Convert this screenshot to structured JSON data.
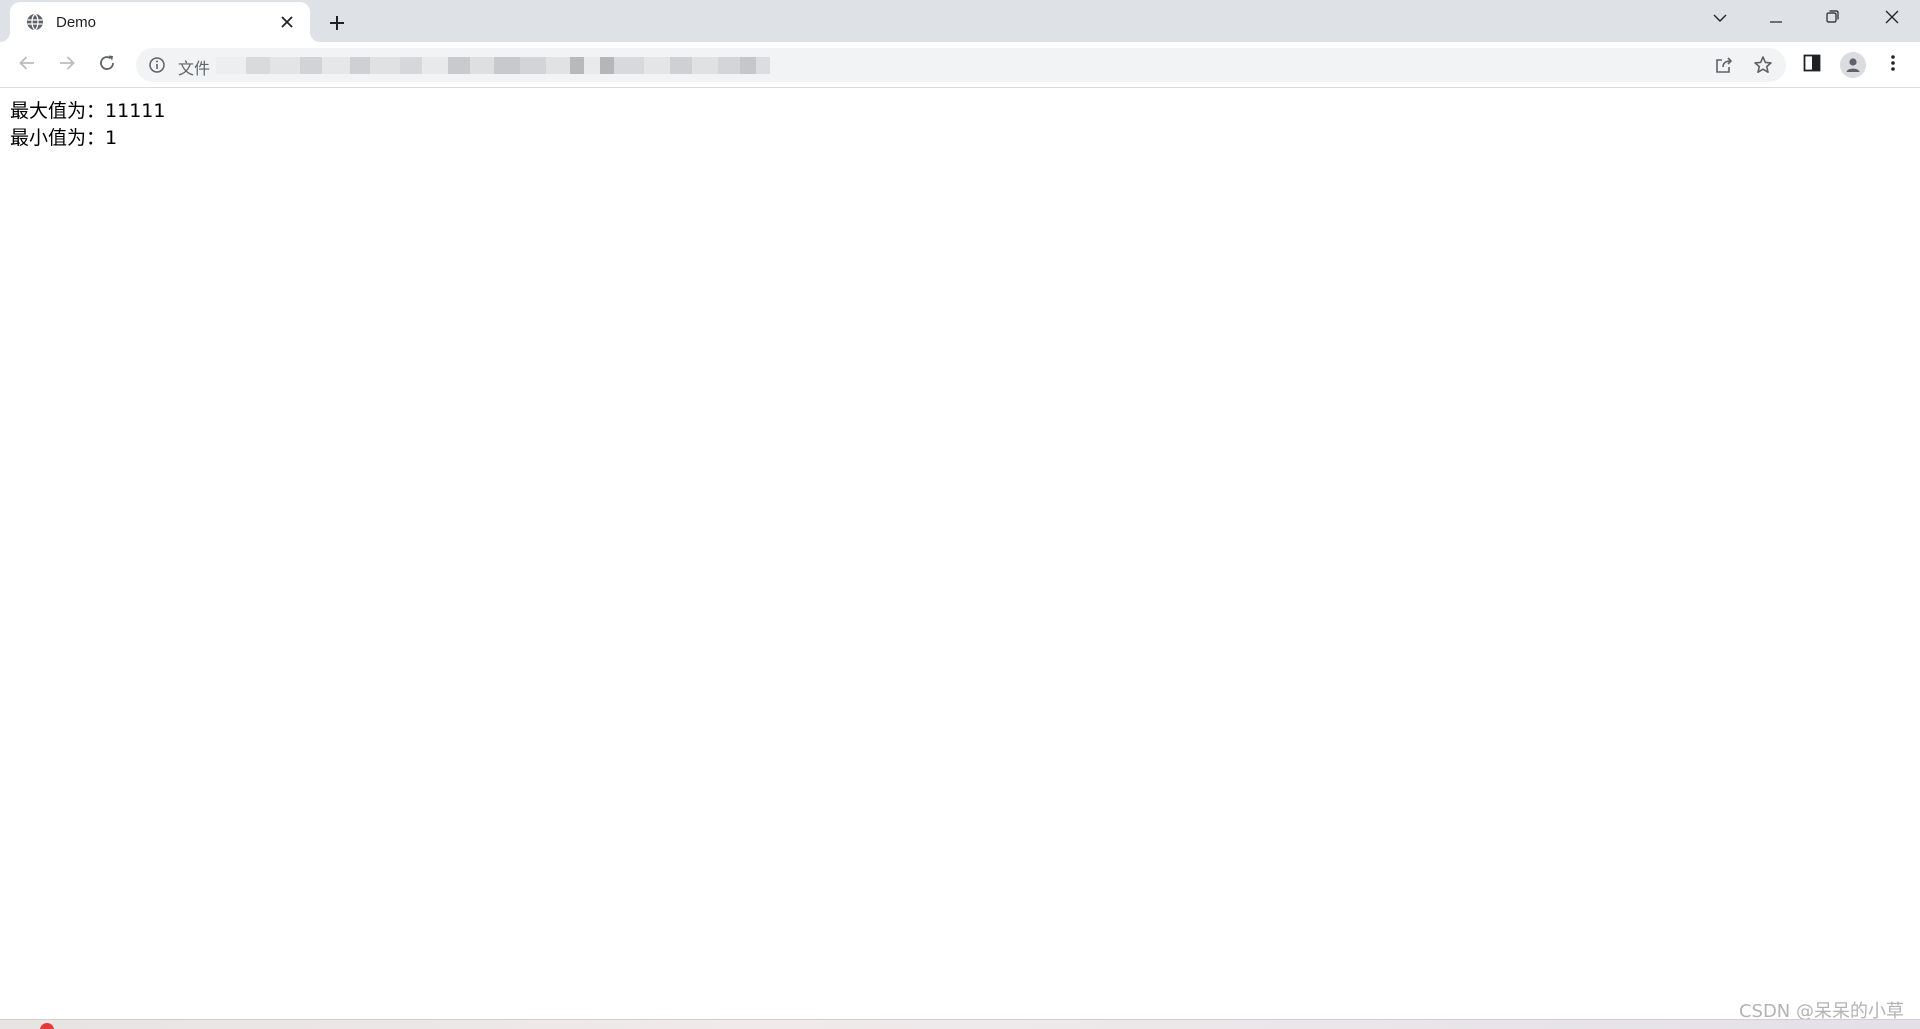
{
  "browser": {
    "tab": {
      "title": "Demo",
      "favicon": "globe-icon"
    },
    "window_controls": [
      "chevron-down-icon",
      "minimize-icon",
      "restore-icon",
      "close-icon"
    ],
    "toolbar": {
      "back": "arrow-left-icon",
      "forward": "arrow-right-icon",
      "reload": "reload-icon",
      "address": {
        "info_icon": "info-icon",
        "label": "文件",
        "url_blurred": true
      },
      "actions": [
        "share-icon",
        "star-icon",
        "side-panel-icon",
        "profile-icon",
        "more-vertical-icon"
      ]
    }
  },
  "page": {
    "lines": [
      {
        "label": "最大值为：",
        "value": "11111"
      },
      {
        "label": "最小值为：",
        "value": "1"
      }
    ]
  },
  "watermark": "CSDN @呆呆的小草"
}
